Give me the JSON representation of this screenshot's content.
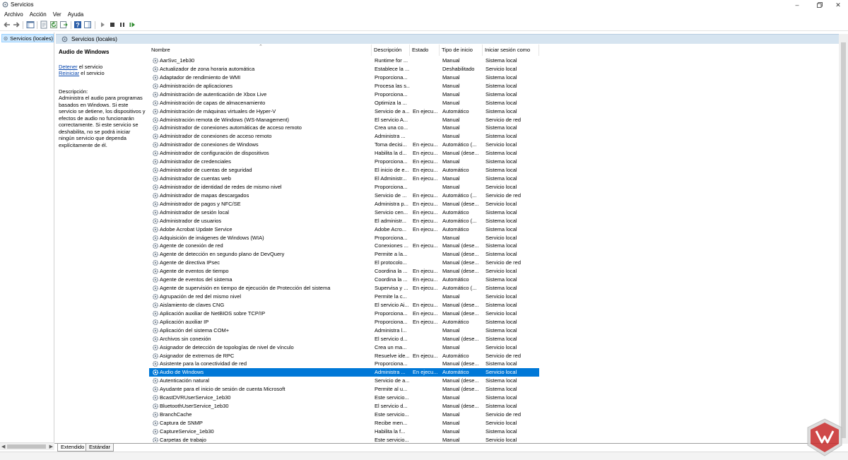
{
  "window": {
    "title": "Servicios"
  },
  "menu": [
    "Archivo",
    "Acción",
    "Ver",
    "Ayuda"
  ],
  "tree": {
    "root_label": "Servicios (locales)"
  },
  "pane": {
    "header": "Servicios (locales)"
  },
  "details": {
    "service_name": "Audio de Windows",
    "stop_link": "Detener",
    "stop_suffix": " el servicio",
    "restart_link": "Reiniciar",
    "restart_suffix": " el servicio",
    "description_label": "Descripción:",
    "description_text": "Administra el audio para programas basados en Windows. Si este servicio se detiene, los dispositivos y efectos de audio no funcionarán correctamente. Si este servicio se deshabilita, no se podrá iniciar ningún servicio que dependa explícitamente de él."
  },
  "columns": {
    "name": "Nombre",
    "description": "Descripción",
    "status": "Estado",
    "startup": "Tipo de inicio",
    "logon": "Iniciar sesión como"
  },
  "services": [
    {
      "name": "AarSvc_1eb30",
      "desc": "Runtime for ...",
      "status": "",
      "type": "Manual",
      "logon": "Sistema local"
    },
    {
      "name": "Actualizador de zona horaria automática",
      "desc": "Establece la ...",
      "status": "",
      "type": "Deshabilitado",
      "logon": "Servicio local"
    },
    {
      "name": "Adaptador de rendimiento de WMI",
      "desc": "Proporciona...",
      "status": "",
      "type": "Manual",
      "logon": "Sistema local"
    },
    {
      "name": "Administración de aplicaciones",
      "desc": "Procesa las s...",
      "status": "",
      "type": "Manual",
      "logon": "Sistema local"
    },
    {
      "name": "Administración de autenticación de Xbox Live",
      "desc": "Proporciona...",
      "status": "",
      "type": "Manual",
      "logon": "Sistema local"
    },
    {
      "name": "Administración de capas de almacenamiento",
      "desc": "Optimiza la ...",
      "status": "",
      "type": "Manual",
      "logon": "Sistema local"
    },
    {
      "name": "Administración de máquinas virtuales de Hyper-V",
      "desc": "Servicio de a...",
      "status": "En ejecu...",
      "type": "Automático",
      "logon": "Sistema local"
    },
    {
      "name": "Administración remota de Windows (WS-Management)",
      "desc": "El servicio A...",
      "status": "",
      "type": "Manual",
      "logon": "Servicio de red"
    },
    {
      "name": "Administrador de conexiones automáticas de acceso remoto",
      "desc": "Crea una co...",
      "status": "",
      "type": "Manual",
      "logon": "Sistema local"
    },
    {
      "name": "Administrador de conexiones de acceso remoto",
      "desc": "Administra ...",
      "status": "",
      "type": "Manual",
      "logon": "Sistema local"
    },
    {
      "name": "Administrador de conexiones de Windows",
      "desc": "Toma decisi...",
      "status": "En ejecu...",
      "type": "Automático (...",
      "logon": "Servicio local"
    },
    {
      "name": "Administrador de configuración de dispositivos",
      "desc": "Habilita la d...",
      "status": "En ejecu...",
      "type": "Manual (dese...",
      "logon": "Sistema local"
    },
    {
      "name": "Administrador de credenciales",
      "desc": "Proporciona...",
      "status": "En ejecu...",
      "type": "Manual",
      "logon": "Sistema local"
    },
    {
      "name": "Administrador de cuentas de seguridad",
      "desc": "El inicio de e...",
      "status": "En ejecu...",
      "type": "Automático",
      "logon": "Sistema local"
    },
    {
      "name": "Administrador de cuentas web",
      "desc": "El Administr...",
      "status": "En ejecu...",
      "type": "Manual",
      "logon": "Sistema local"
    },
    {
      "name": "Administrador de identidad de redes de mismo nivel",
      "desc": "Proporciona...",
      "status": "",
      "type": "Manual",
      "logon": "Servicio local"
    },
    {
      "name": "Administrador de mapas descargados",
      "desc": "Servicio de ...",
      "status": "En ejecu...",
      "type": "Automático (...",
      "logon": "Servicio de red"
    },
    {
      "name": "Administrador de pagos y NFC/SE",
      "desc": "Administra p...",
      "status": "En ejecu...",
      "type": "Manual (dese...",
      "logon": "Servicio local"
    },
    {
      "name": "Administrador de sesión local",
      "desc": "Servicio cen...",
      "status": "En ejecu...",
      "type": "Automático",
      "logon": "Sistema local"
    },
    {
      "name": "Administrador de usuarios",
      "desc": "El administr...",
      "status": "En ejecu...",
      "type": "Automático (...",
      "logon": "Sistema local"
    },
    {
      "name": "Adobe Acrobat Update Service",
      "desc": "Adobe Acro...",
      "status": "En ejecu...",
      "type": "Automático",
      "logon": "Sistema local"
    },
    {
      "name": "Adquisición de imágenes de Windows (WIA)",
      "desc": "Proporciona...",
      "status": "",
      "type": "Manual",
      "logon": "Servicio local"
    },
    {
      "name": "Agente de conexión de red",
      "desc": "Conexiones ...",
      "status": "En ejecu...",
      "type": "Manual (dese...",
      "logon": "Sistema local"
    },
    {
      "name": "Agente de detección en segundo plano de DevQuery",
      "desc": "Permite a la...",
      "status": "",
      "type": "Manual (dese...",
      "logon": "Sistema local"
    },
    {
      "name": "Agente de directiva IPsec",
      "desc": "El protocolo...",
      "status": "",
      "type": "Manual (dese...",
      "logon": "Servicio de red"
    },
    {
      "name": "Agente de eventos de tiempo",
      "desc": "Coordina la ...",
      "status": "En ejecu...",
      "type": "Manual (dese...",
      "logon": "Servicio local"
    },
    {
      "name": "Agente de eventos del sistema",
      "desc": "Coordina la ...",
      "status": "En ejecu...",
      "type": "Automático",
      "logon": "Sistema local"
    },
    {
      "name": "Agente de supervisión en tiempo de ejecución de Protección del sistema",
      "desc": "Supervisa y ...",
      "status": "En ejecu...",
      "type": "Automático (...",
      "logon": "Sistema local"
    },
    {
      "name": "Agrupación de red del mismo nivel",
      "desc": "Permite la c...",
      "status": "",
      "type": "Manual",
      "logon": "Servicio local"
    },
    {
      "name": "Aislamiento de claves CNG",
      "desc": "El servicio Ai...",
      "status": "En ejecu...",
      "type": "Manual (dese...",
      "logon": "Sistema local"
    },
    {
      "name": "Aplicación auxiliar de NetBIOS sobre TCP/IP",
      "desc": "Proporciona...",
      "status": "En ejecu...",
      "type": "Manual (dese...",
      "logon": "Servicio local"
    },
    {
      "name": "Aplicación auxiliar IP",
      "desc": "Proporciona...",
      "status": "En ejecu...",
      "type": "Automático",
      "logon": "Sistema local"
    },
    {
      "name": "Aplicación del sistema COM+",
      "desc": "Administra l...",
      "status": "",
      "type": "Manual",
      "logon": "Sistema local"
    },
    {
      "name": "Archivos sin conexión",
      "desc": "El servicio d...",
      "status": "",
      "type": "Manual (dese...",
      "logon": "Sistema local"
    },
    {
      "name": "Asignador de detección de topologías de nivel de vínculo",
      "desc": "Crea un ma...",
      "status": "",
      "type": "Manual",
      "logon": "Servicio local"
    },
    {
      "name": "Asignador de extremos de RPC",
      "desc": "Resuelve ide...",
      "status": "En ejecu...",
      "type": "Automático",
      "logon": "Servicio de red"
    },
    {
      "name": "Asistente para la conectividad de red",
      "desc": "Proporciona...",
      "status": "",
      "type": "Manual (dese...",
      "logon": "Sistema local"
    },
    {
      "name": "Audio de Windows",
      "desc": "Administra ...",
      "status": "En ejecu...",
      "type": "Automático",
      "logon": "Servicio local",
      "selected": true
    },
    {
      "name": "Autenticación natural",
      "desc": "Servicio de a...",
      "status": "",
      "type": "Manual (dese...",
      "logon": "Sistema local"
    },
    {
      "name": "Ayudante para el inicio de sesión de cuenta Microsoft",
      "desc": "Permite al u...",
      "status": "",
      "type": "Manual (dese...",
      "logon": "Sistema local"
    },
    {
      "name": "BcastDVRUserService_1eb30",
      "desc": "Este servicio...",
      "status": "",
      "type": "Manual",
      "logon": "Sistema local"
    },
    {
      "name": "BluetoothUserService_1eb30",
      "desc": "El servicio d...",
      "status": "",
      "type": "Manual (dese...",
      "logon": "Sistema local"
    },
    {
      "name": "BranchCache",
      "desc": "Este servicio...",
      "status": "",
      "type": "Manual",
      "logon": "Servicio de red"
    },
    {
      "name": "Captura de SNMP",
      "desc": "Recibe men...",
      "status": "",
      "type": "Manual",
      "logon": "Servicio local"
    },
    {
      "name": "CaptureService_1eb30",
      "desc": "Habilita la f...",
      "status": "",
      "type": "Manual",
      "logon": "Sistema local"
    },
    {
      "name": "Carpetas de trabajo",
      "desc": "Este servicio...",
      "status": "",
      "type": "Manual",
      "logon": "Servicio local"
    }
  ],
  "tabs": [
    "Extendido",
    "Estándar"
  ]
}
